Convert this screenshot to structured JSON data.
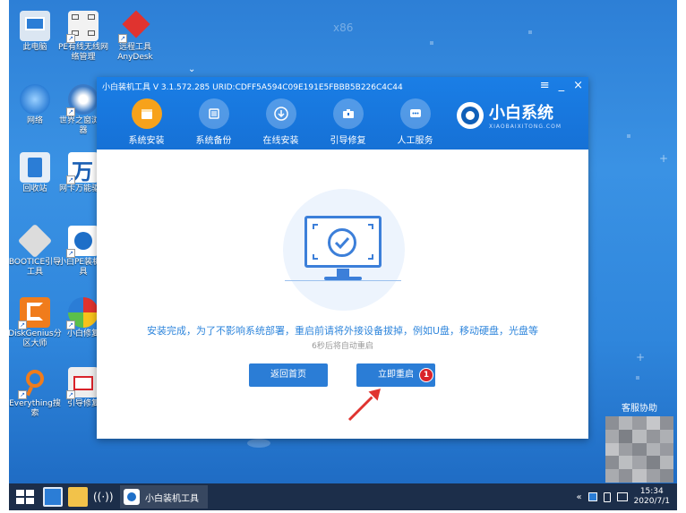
{
  "desktop": {
    "watermark": "x86",
    "icons": [
      {
        "label": "此电脑",
        "icon": "computer-icon",
        "color": "#d8e4f0"
      },
      {
        "label": "PE有线无线网络管理",
        "icon": "network-manager-icon",
        "color": "#e8e8e8"
      },
      {
        "label": "远程工具AnyDesk",
        "icon": "anydesk-icon",
        "color": "#e0332f"
      },
      {
        "label": "网络",
        "icon": "network-globe-icon",
        "color": "#cfe1f5"
      },
      {
        "label": "世界之窗浏览器",
        "icon": "browser-icon",
        "color": "#e8eef6"
      },
      {
        "label": "回收站",
        "icon": "recycle-bin-icon",
        "color": "#cfe1f5"
      },
      {
        "label": "网卡万能驱动",
        "icon": "driver-icon",
        "color": "#ffffff"
      },
      {
        "label": "BOOTICE引导工具",
        "icon": "bootice-icon",
        "color": "#e8e8e8"
      },
      {
        "label": "小白PE装机工具",
        "icon": "xiaobai-icon",
        "color": "#ffffff"
      },
      {
        "label": "DiskGenius分区大师",
        "icon": "diskgenius-icon",
        "color": "#f07c1c"
      },
      {
        "label": "小白修复",
        "icon": "pinwheel-icon",
        "color": "#5bbf4a"
      },
      {
        "label": "Everything搜索",
        "icon": "search-icon",
        "color": "#f07c1c"
      },
      {
        "label": "引导修复",
        "icon": "repair-icon",
        "color": "#e6e6e6"
      }
    ],
    "widget_title": "客服协助"
  },
  "window": {
    "title": "小白装机工具 V 3.1.572.285 URID:CDFF5A594C09E191E5FBBB5B226C4C44",
    "nav": [
      {
        "label": "系统安装",
        "icon": "install-icon",
        "active": true
      },
      {
        "label": "系统备份",
        "icon": "backup-icon",
        "active": false
      },
      {
        "label": "在线安装",
        "icon": "download-icon",
        "active": false
      },
      {
        "label": "引导修复",
        "icon": "toolbox-icon",
        "active": false
      },
      {
        "label": "人工服务",
        "icon": "chat-icon",
        "active": false
      }
    ],
    "brand": {
      "name": "小白系统",
      "sub": "XIAOBAIXITONG.COM"
    },
    "message": "安装完成，为了不影响系统部署，重启前请将外接设备拔掉，例如U盘，移动硬盘，光盘等",
    "countdown": "6秒后将自动重启",
    "back_button": "返回首页",
    "restart_button": "立即重启",
    "badge": "1"
  },
  "taskbar": {
    "app_label": "小白装机工具",
    "time": "15:34",
    "date": "2020/7/1"
  },
  "colors": {
    "accent": "#2b7dd6",
    "active_tab": "#f7a21b",
    "badge": "#d9232a"
  }
}
